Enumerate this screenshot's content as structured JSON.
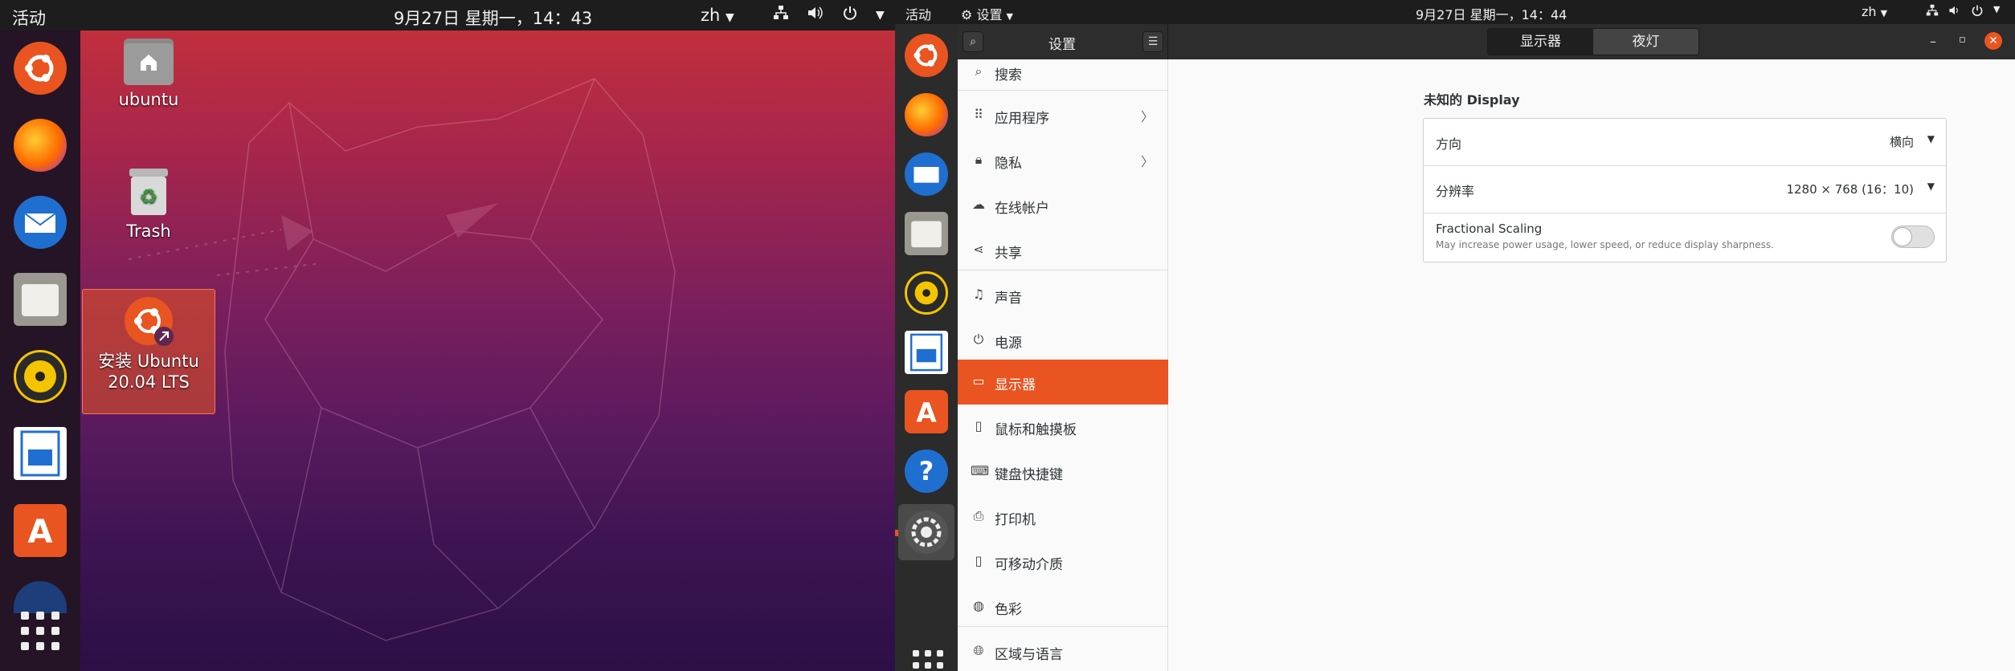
{
  "left_screen": {
    "topbar": {
      "activities": "活动",
      "clock": "9月27日 星期一，14：43",
      "ime": "zh",
      "tray_icons": [
        "network-icon",
        "volume-icon",
        "power-icon",
        "chevron-down-icon"
      ]
    },
    "dock_apps": [
      "ubuntu-installer-icon",
      "firefox-icon",
      "thunderbird-icon",
      "files-icon",
      "rhythmbox-icon",
      "writer-icon",
      "software-icon",
      "help-icon"
    ],
    "desktop_items": {
      "home": "ubuntu",
      "trash": "Trash",
      "installer": "安装 Ubuntu 20.04 LTS"
    }
  },
  "right_screen": {
    "topbar": {
      "activities": "活动",
      "app_menu": "设置",
      "clock": "9月27日 星期一，14：44",
      "ime": "zh"
    },
    "headerbar": {
      "title": "设置",
      "tabs": [
        {
          "label": "显示器",
          "active": true
        },
        {
          "label": "夜灯",
          "active": false
        }
      ],
      "window_controls": [
        "minimize",
        "maximize",
        "close"
      ]
    },
    "sidebar": {
      "items": [
        {
          "icon": "search-icon",
          "label": "搜索",
          "chevron": false
        },
        {
          "icon": "apps-icon",
          "label": "应用程序",
          "chevron": true
        },
        {
          "icon": "lock-icon",
          "label": "隐私",
          "chevron": true
        },
        {
          "icon": "cloud-icon",
          "label": "在线帐户",
          "chevron": false
        },
        {
          "icon": "share-icon",
          "label": "共享",
          "chevron": false
        },
        {
          "icon": "music-icon",
          "label": "声音",
          "chevron": false
        },
        {
          "icon": "power-icon",
          "label": "电源",
          "chevron": false
        },
        {
          "icon": "display-icon",
          "label": "显示器",
          "chevron": false,
          "active": true
        },
        {
          "icon": "mouse-icon",
          "label": "鼠标和触摸板",
          "chevron": false
        },
        {
          "icon": "keyboard-icon",
          "label": "键盘快捷键",
          "chevron": false
        },
        {
          "icon": "printer-icon",
          "label": "打印机",
          "chevron": false
        },
        {
          "icon": "usb-icon",
          "label": "可移动介质",
          "chevron": false
        },
        {
          "icon": "color-icon",
          "label": "色彩",
          "chevron": false
        },
        {
          "icon": "globe-icon",
          "label": "区域与语言",
          "chevron": false
        }
      ]
    },
    "display": {
      "title": "未知的 Display",
      "orientation_label": "方向",
      "orientation_value": "横向",
      "resolution_label": "分辨率",
      "resolution_value": "1280 × 768 (16：10)",
      "fractional_title": "Fractional Scaling",
      "fractional_desc": "May increase power usage, lower speed, or reduce display sharpness.",
      "fractional_enabled": false
    },
    "colors": {
      "accent": "#e95420"
    }
  }
}
